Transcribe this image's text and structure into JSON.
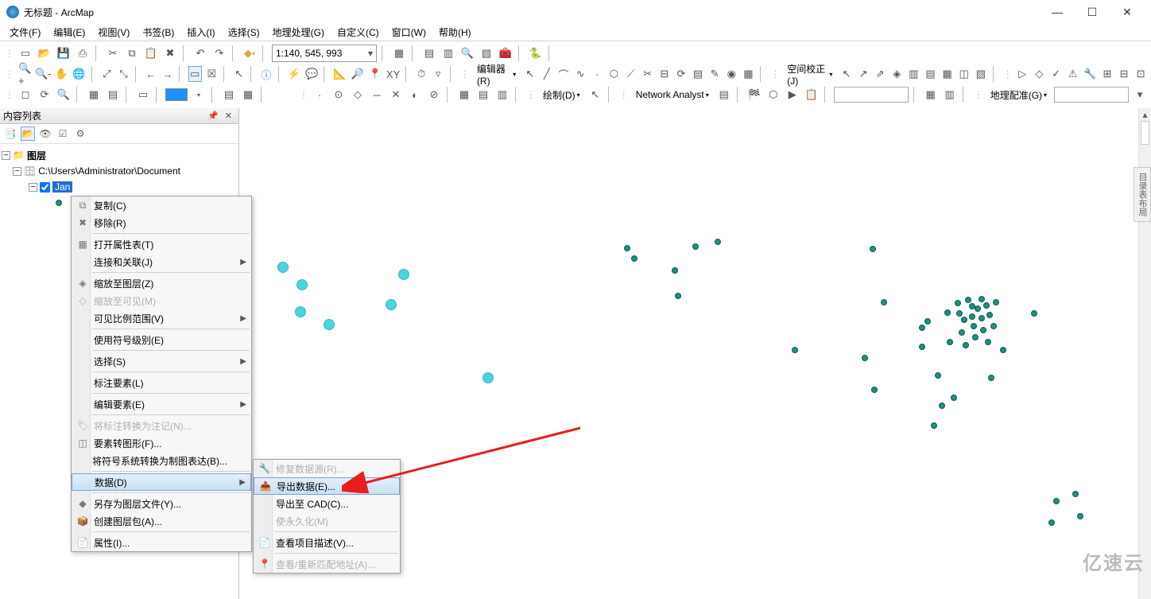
{
  "titlebar": {
    "document_name": "无标题",
    "app_name": "ArcMap"
  },
  "menu": {
    "file": "文件(F)",
    "edit": "编辑(E)",
    "view": "视图(V)",
    "bookmarks": "书签(B)",
    "insert": "插入(I)",
    "selection": "选择(S)",
    "geoprocessing": "地理处理(G)",
    "customize": "自定义(C)",
    "window": "窗口(W)",
    "help": "帮助(H)"
  },
  "toolbar": {
    "scale": "1:140, 545, 993",
    "editor": "编辑器(R)",
    "spatial_adjustment": "空间校正(J)",
    "drawing": "绘制(D)",
    "network_analyst": "Network Analyst",
    "georeferencing": "地理配准(G)"
  },
  "toc": {
    "title": "内容列表",
    "layers_root": "图层",
    "workspace_path": "C:\\Users\\Administrator\\Document",
    "layer_name": "Jan"
  },
  "context_menu": {
    "copy": "复制(C)",
    "remove": "移除(R)",
    "open_attr_table": "打开属性表(T)",
    "joins_relates": "连接和关联(J)",
    "zoom_to_layer": "缩放至图层(Z)",
    "zoom_to_visible": "缩放至可见(M)",
    "visible_scale_range": "可见比例范围(V)",
    "use_symbol_levels": "使用符号级别(E)",
    "selection": "选择(S)",
    "label_features": "标注要素(L)",
    "edit_features": "编辑要素(E)",
    "convert_labels_anno": "将标注转换为注记(N)...",
    "features_to_graphics": "要素转图形(F)...",
    "symbology_to_rep": "将符号系统转换为制图表达(B)...",
    "data": "数据(D)",
    "save_as_layer_file": "另存为图层文件(Y)...",
    "create_layer_package": "创建图层包(A)...",
    "properties": "属性(I)..."
  },
  "submenu_data": {
    "repair_data_source": "修复数据源(R)...",
    "export_data": "导出数据(E)...",
    "export_to_cad": "导出至 CAD(C)...",
    "make_permanent": "使永久化(M)",
    "view_item_desc": "查看项目描述(V)...",
    "review_rematch": "查看/重新匹配地址(A)..."
  },
  "watermark": "亿速云",
  "right_tab": "目录表布局"
}
